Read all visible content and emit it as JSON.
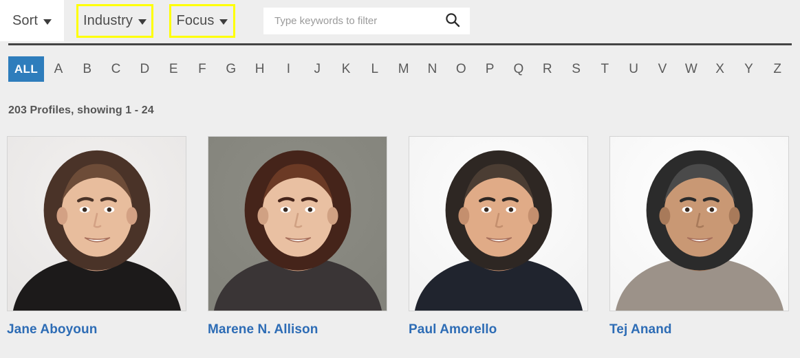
{
  "toolbar": {
    "sort_label": "Sort",
    "industry_label": "Industry",
    "focus_label": "Focus",
    "search_placeholder": "Type keywords to filter",
    "search_value": "",
    "search_icon": "search-icon",
    "caret_icon": "chevron-down-icon",
    "highlight_color": "#ffff00"
  },
  "alphabet_nav": {
    "all_label": "ALL",
    "active": "ALL",
    "active_color": "#2e7dbc",
    "letters": [
      "A",
      "B",
      "C",
      "D",
      "E",
      "F",
      "G",
      "H",
      "I",
      "J",
      "K",
      "L",
      "M",
      "N",
      "O",
      "P",
      "Q",
      "R",
      "S",
      "T",
      "U",
      "V",
      "W",
      "X",
      "Y",
      "Z"
    ]
  },
  "results": {
    "count_text": "203 Profiles, showing 1 - 24",
    "total": 203,
    "showing_from": 1,
    "showing_to": 24
  },
  "profiles": [
    {
      "name": "Jane Aboyoun",
      "photo_alt": "portrait-jane-aboyoun",
      "bg": "#f2f0ef",
      "hair": "#4a3328",
      "hair_light": "#6d4c38",
      "skin": "#e8bd9d",
      "skin_shadow": "#d3a184",
      "clothing": "#1c1a1a",
      "accent": "#9b9490"
    },
    {
      "name": "Marene N. Allison",
      "photo_alt": "portrait-marene-n-allison",
      "bg": "#8d8d85",
      "hair": "#45241a",
      "hair_light": "#6b3a25",
      "skin": "#e9c0a2",
      "skin_shadow": "#d0a183",
      "clothing": "#3a3536",
      "accent": "#b3b0a6"
    },
    {
      "name": "Paul Amorello",
      "photo_alt": "portrait-paul-amorello",
      "bg": "#fdfdfd",
      "hair": "#2e2723",
      "hair_light": "#4b3d33",
      "skin": "#e0ab87",
      "skin_shadow": "#c48f6e",
      "clothing": "#20242e",
      "accent": "#7e9cc4"
    },
    {
      "name": "Tej Anand",
      "photo_alt": "portrait-tej-anand",
      "bg": "#ffffff",
      "hair": "#2b2b2b",
      "hair_light": "#4a4a4a",
      "skin": "#c99874",
      "skin_shadow": "#a87a5a",
      "clothing": "#9c9289",
      "accent": "#d8d0c0"
    }
  ]
}
